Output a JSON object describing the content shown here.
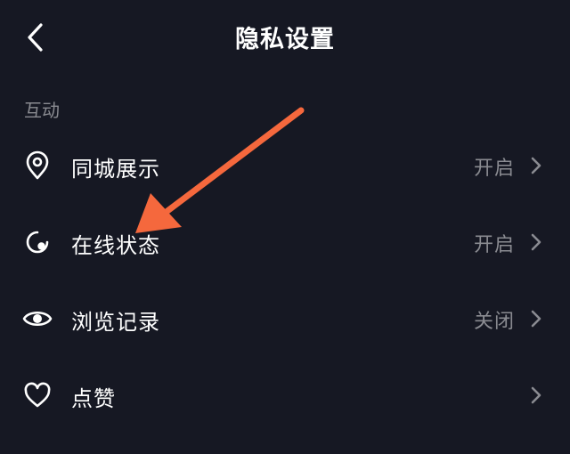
{
  "header": {
    "title": "隐私设置",
    "back_icon": "chevron-left-icon"
  },
  "section": {
    "label": "互动"
  },
  "settings": [
    {
      "label": "同城展示",
      "value": "开启",
      "icon": "location-pin-icon"
    },
    {
      "label": "在线状态",
      "value": "开启",
      "icon": "online-status-icon"
    },
    {
      "label": "浏览记录",
      "value": "关闭",
      "icon": "eye-icon"
    },
    {
      "label": "点赞",
      "value": "",
      "icon": "heart-icon"
    }
  ],
  "colors": {
    "background": "#161823",
    "text_primary": "#ffffff",
    "text_secondary": "#8a8b91",
    "annotation_arrow": "#f5683d"
  }
}
